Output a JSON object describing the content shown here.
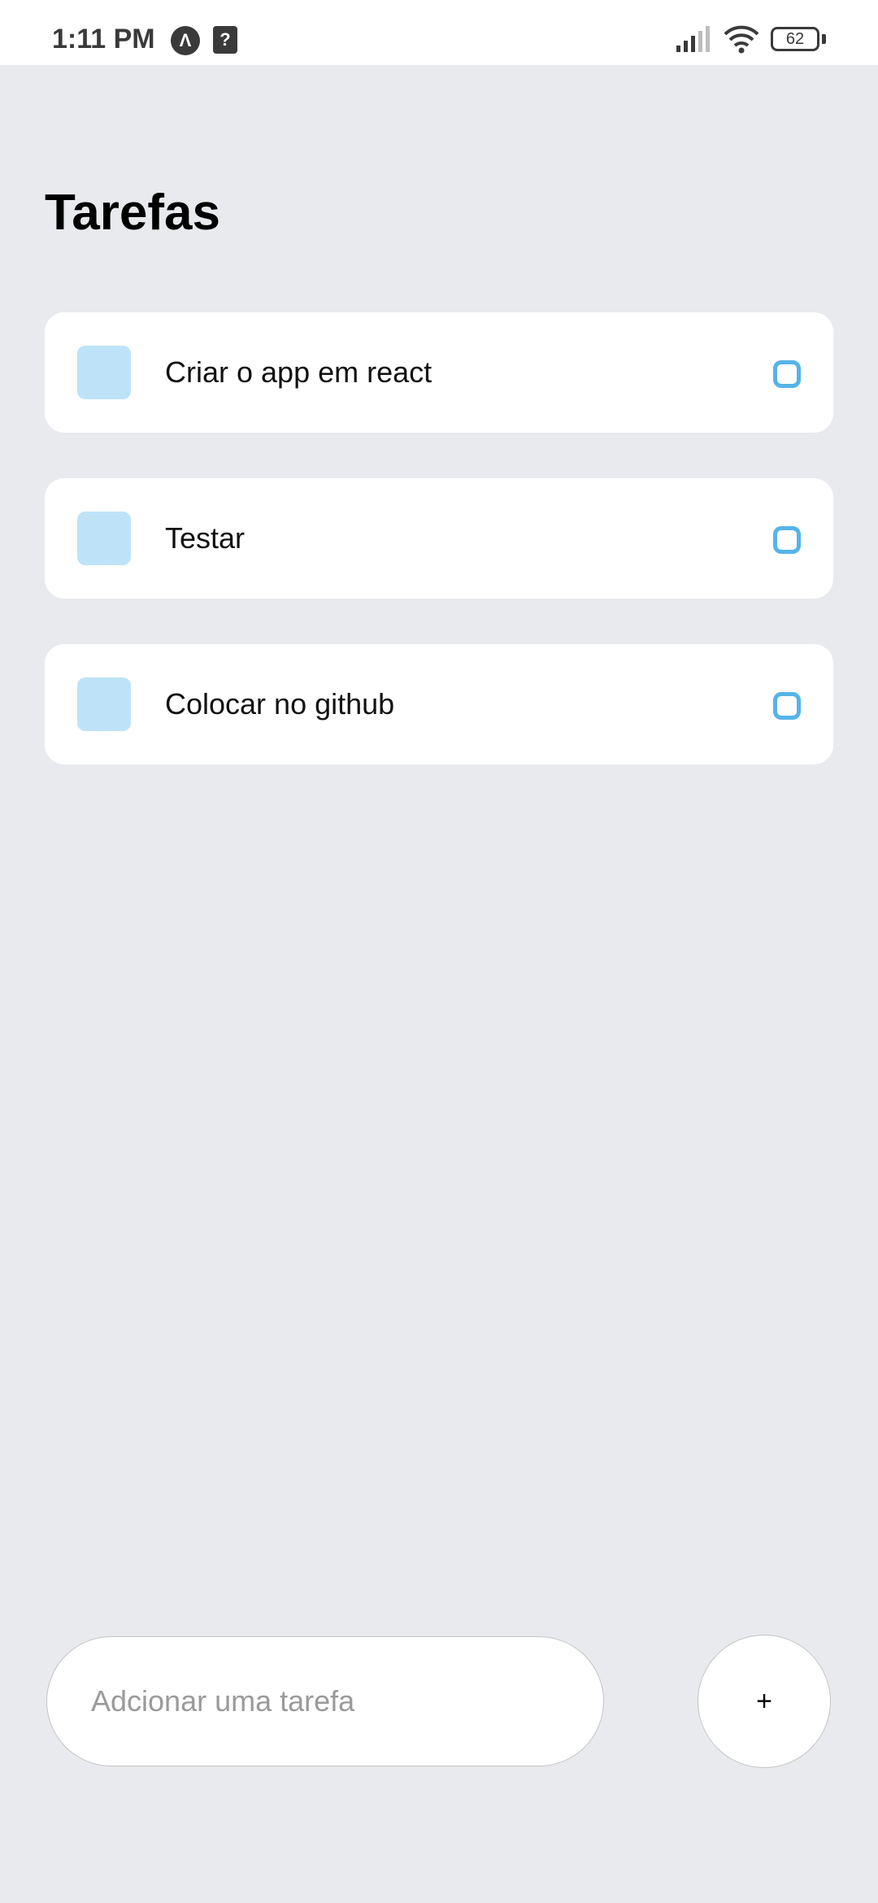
{
  "status_bar": {
    "time": "1:11 PM",
    "app_icon": "Λ",
    "question_icon": "?",
    "battery_level": "62",
    "icons": [
      "signal-icon",
      "wifi-icon",
      "battery-icon"
    ]
  },
  "header": {
    "title": "Tarefas"
  },
  "tasks": [
    {
      "label": "Criar o app em react",
      "completed": false
    },
    {
      "label": "Testar",
      "completed": false
    },
    {
      "label": "Colocar no github",
      "completed": false
    }
  ],
  "composer": {
    "placeholder": "Adcionar uma tarefa",
    "value": "",
    "add_button_label": "+"
  },
  "colors": {
    "background": "#E8EAED",
    "card": "#FFFFFF",
    "task_square": "#BEE3F8",
    "task_circle": "#55B4E8"
  }
}
